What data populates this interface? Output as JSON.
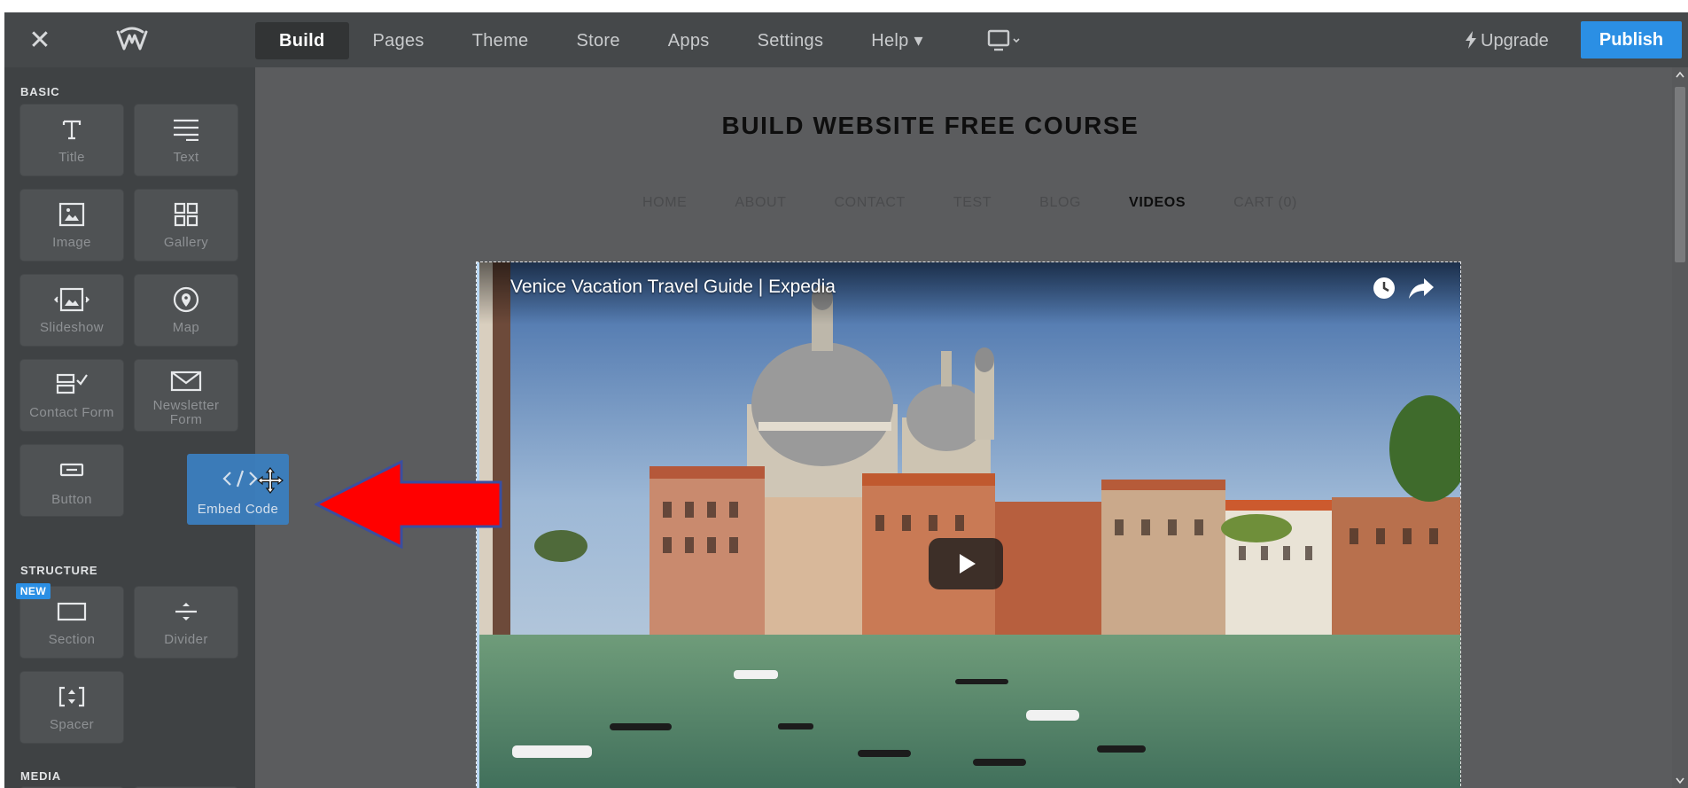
{
  "topbar": {
    "nav": [
      {
        "label": "Build",
        "active": true
      },
      {
        "label": "Pages"
      },
      {
        "label": "Theme"
      },
      {
        "label": "Store"
      },
      {
        "label": "Apps"
      },
      {
        "label": "Settings"
      },
      {
        "label": "Help ▾"
      }
    ],
    "upgrade_label": "Upgrade",
    "publish_label": "Publish",
    "icons": [
      "close-icon",
      "weebly-logo-icon",
      "desktop-device-icon",
      "lightning-icon"
    ]
  },
  "sidebar": {
    "basic_label": "BASIC",
    "structure_label": "STRUCTURE",
    "media_label": "MEDIA",
    "new_badge": "NEW",
    "tiles": {
      "title": "Title",
      "text": "Text",
      "image": "Image",
      "gallery": "Gallery",
      "slideshow": "Slideshow",
      "map": "Map",
      "contact_form": "Contact Form",
      "newsletter_form_1": "Newsletter",
      "newsletter_form_2": "Form",
      "button": "Button",
      "section": "Section",
      "divider": "Divider",
      "spacer": "Spacer"
    },
    "dragging_tile": "Embed Code"
  },
  "canvas": {
    "site_title": "BUILD WEBSITE FREE COURSE",
    "site_nav": [
      "HOME",
      "ABOUT",
      "CONTACT",
      "TEST",
      "BLOG",
      "VIDEOS",
      "CART (0)"
    ],
    "site_nav_current": "VIDEOS",
    "video_title": "Venice Vacation Travel Guide | Expedia"
  },
  "colors": {
    "topbar": "#45484a",
    "sidebar": "#3f4244",
    "canvas": "#5b5c5e",
    "accent": "#2b8fe4",
    "annotation_arrow": "#ff0000"
  }
}
